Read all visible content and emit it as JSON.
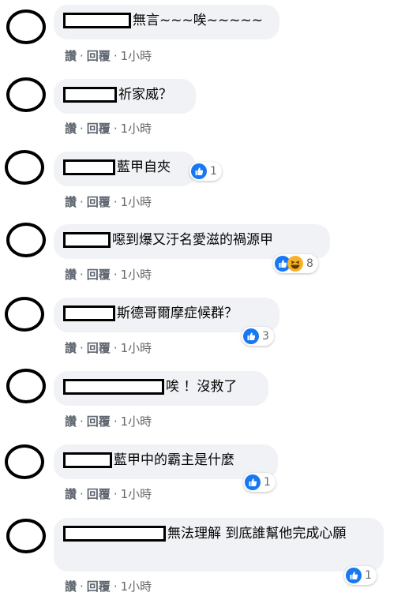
{
  "comments": [
    {
      "text": "無言~~~唉~~~~~",
      "reaction_count": ""
    },
    {
      "text": "祈家威？",
      "reaction_count": ""
    },
    {
      "text": "藍甲自夾",
      "reaction_count": "1"
    },
    {
      "text": "噁到爆又汙名愛滋的禍源甲",
      "reaction_count": "8"
    },
    {
      "text": "斯德哥爾摩症候群？",
      "reaction_count": "3"
    },
    {
      "text": "唉 ！沒救了",
      "reaction_count": ""
    },
    {
      "text": "藍甲中的霸主是什麼",
      "reaction_count": "1"
    },
    {
      "text": "無法理解 到底誰幫他完成心願",
      "reaction_count": "1"
    }
  ],
  "actions": {
    "like": "讚",
    "reply": "回覆",
    "sep": "·",
    "time": "1小時"
  },
  "colors": {
    "bubble": "#f0f2f5",
    "like_blue": "#1877f2",
    "haha_yellow": "#f7b125",
    "meta_gray": "#65676b"
  },
  "icons": [
    "like-icon",
    "haha-icon"
  ]
}
